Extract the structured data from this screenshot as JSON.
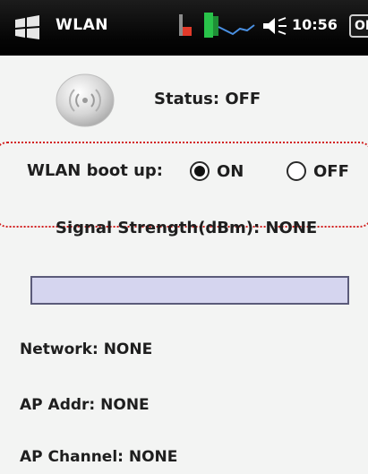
{
  "statusbar": {
    "app_title": "WLAN",
    "clock": "10:56",
    "ok_label": "OK",
    "icons": [
      "windows-start-icon",
      "app-tray-icon",
      "signal-graph-icon",
      "volume-icon"
    ]
  },
  "status": {
    "label": "Status:",
    "value": "OFF",
    "icon": "wifi-radio-icon"
  },
  "boot": {
    "label": "WLAN boot up:",
    "options": [
      {
        "label": "ON",
        "selected": true
      },
      {
        "label": "OFF",
        "selected": false
      }
    ]
  },
  "signal": {
    "label": "Signal Strength(dBm):",
    "value": "NONE",
    "level": 0
  },
  "info": {
    "network": {
      "label": "Network:",
      "value": "NONE"
    },
    "ap_addr": {
      "label": "AP Addr:",
      "value": "NONE"
    },
    "ap_channel": {
      "label": "AP Channel:",
      "value": "NONE"
    }
  },
  "colors": {
    "statusbar_bg": "#000000",
    "content_bg": "#f3f4f3",
    "highlight_border": "#d21f1f",
    "signal_bar_fill": "#d5d5ef",
    "signal_bar_border": "#5b5b7a"
  }
}
